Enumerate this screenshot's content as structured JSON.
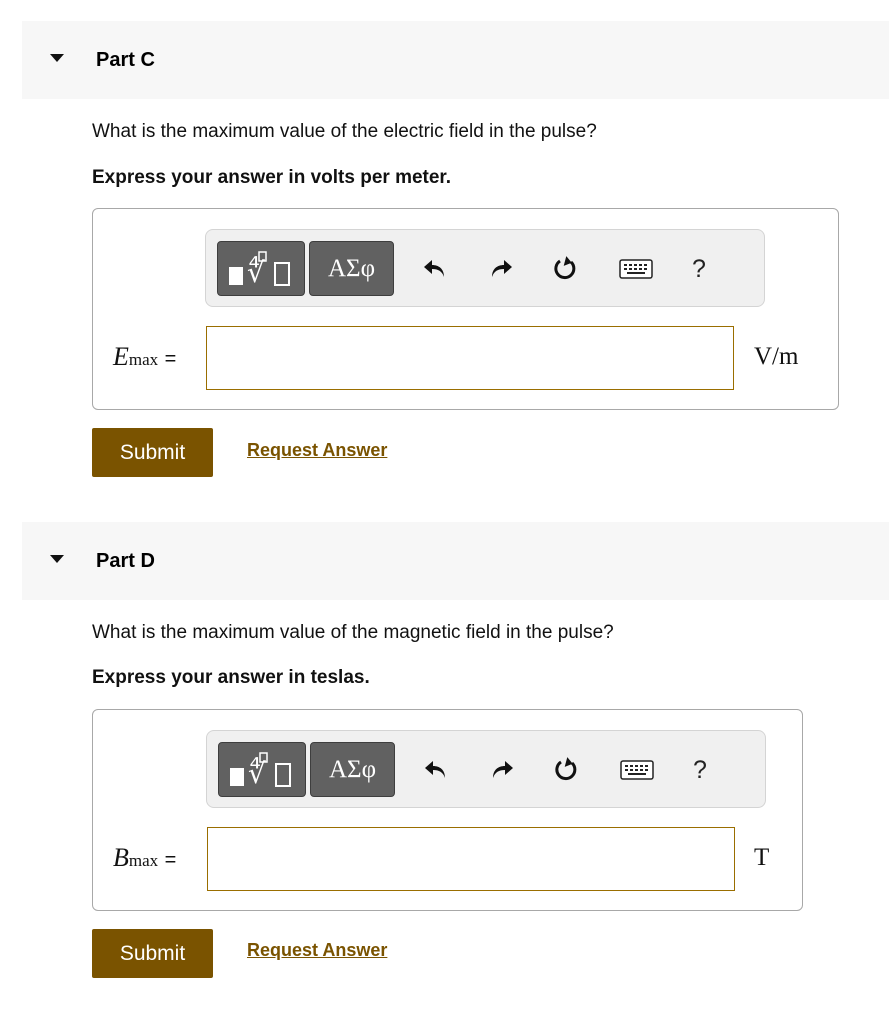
{
  "parts": [
    {
      "title": "Part C",
      "question": "What is the maximum value of the electric field in the pulse?",
      "instruction": "Express your answer in volts per meter.",
      "variable": {
        "symbol": "E",
        "subscript": "max",
        "equals": "="
      },
      "input_value": "",
      "unit": "V/m",
      "submit_label": "Submit",
      "request_label": "Request Answer"
    },
    {
      "title": "Part D",
      "question": "What is the maximum value of the magnetic field in the pulse?",
      "instruction": "Express your answer in teslas.",
      "variable": {
        "symbol": "B",
        "subscript": "max",
        "equals": "="
      },
      "input_value": "",
      "unit": "T",
      "submit_label": "Submit",
      "request_label": "Request Answer"
    }
  ],
  "toolbar": {
    "greek_label": "ΑΣφ",
    "help_label": "?",
    "icons": [
      "templates-icon",
      "undo-icon",
      "redo-icon",
      "reset-icon",
      "keyboard-icon",
      "help-icon"
    ]
  },
  "colors": {
    "accent": "#7a5300",
    "header_bg": "#f7f7f7",
    "toolbar_bg": "#f0f0f0",
    "toolbar_button": "#616161",
    "input_border": "#9a6e00"
  }
}
